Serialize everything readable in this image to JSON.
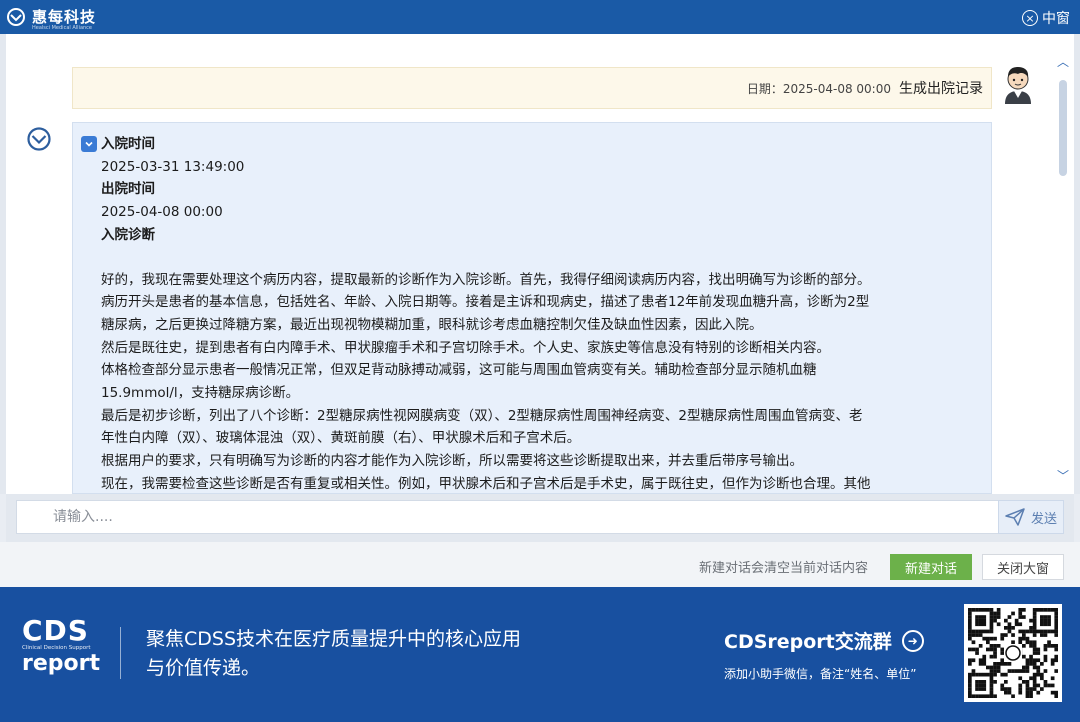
{
  "titlebar": {
    "brand_name": "惠每科技",
    "brand_sub": "Healsci Medical Alliance",
    "window_btn_label": "中窗"
  },
  "chat": {
    "user_message": {
      "date_label": "日期：2025-04-08 00:00",
      "text": "生成出院记录"
    },
    "bot_message": {
      "lines": [
        {
          "kind": "hd",
          "text": "入院时间"
        },
        {
          "kind": "p",
          "text": "2025-03-31 13:49:00"
        },
        {
          "kind": "hd",
          "text": "出院时间"
        },
        {
          "kind": "p",
          "text": "2025-04-08 00:00"
        },
        {
          "kind": "hd",
          "text": "入院诊断"
        },
        {
          "kind": "gap",
          "text": ""
        },
        {
          "kind": "p",
          "text": "好的，我现在需要处理这个病历内容，提取最新的诊断作为入院诊断。首先，我得仔细阅读病历内容，找出明确写为诊断的部分。"
        },
        {
          "kind": "p",
          "text": "病历开头是患者的基本信息，包括姓名、年龄、入院日期等。接着是主诉和现病史，描述了患者12年前发现血糖升高，诊断为2型"
        },
        {
          "kind": "p",
          "text": "糖尿病，之后更换过降糖方案，最近出现视物模糊加重，眼科就诊考虑血糖控制欠佳及缺血性因素，因此入院。"
        },
        {
          "kind": "p",
          "text": "然后是既往史，提到患者有白内障手术、甲状腺瘤手术和子宫切除手术。个人史、家族史等信息没有特别的诊断相关内容。"
        },
        {
          "kind": "p",
          "text": "体格检查部分显示患者一般情况正常，但双足背动脉搏动减弱，这可能与周围血管病变有关。辅助检查部分显示随机血糖"
        },
        {
          "kind": "p",
          "text": "15.9mmol/l，支持糖尿病诊断。"
        },
        {
          "kind": "p",
          "text": "最后是初步诊断，列出了八个诊断：2型糖尿病性视网膜病变（双）、2型糖尿病性周围神经病变、2型糖尿病性周围血管病变、老"
        },
        {
          "kind": "p",
          "text": "年性白内障（双）、玻璃体混浊（双）、黄斑前膜（右）、甲状腺术后和子宫术后。"
        },
        {
          "kind": "p",
          "text": "根据用户的要求，只有明确写为诊断的内容才能作为入院诊断，所以需要将这些诊断提取出来，并去重后带序号输出。"
        },
        {
          "kind": "p",
          "text": "现在，我需要检查这些诊断是否有重复或相关性。例如，甲状腺术后和子宫术后是手术史，属于既往史，但作为诊断也合理。其他"
        }
      ]
    }
  },
  "input": {
    "placeholder": "请输入....",
    "send_label": "发送"
  },
  "actions": {
    "hint": "新建对话会清空当前对话内容",
    "new_chat_label": "新建对话",
    "close_label": "关闭大窗"
  },
  "banner": {
    "logo_big": "CDS",
    "logo_small": "Clinical Decision Support",
    "logo_report": "report",
    "slogan_line1": "聚焦CDSS技术在医疗质量提升中的核心应用",
    "slogan_line2": "与价值传递。",
    "group_title": "CDSreport交流群",
    "group_sub": "添加小助手微信，备注“姓名、单位”"
  },
  "colors": {
    "titlebar": "#1a5aa6",
    "banner": "#1850a0",
    "new_chat_button": "#6cb14a",
    "bot_bubble": "#e8f0fb",
    "user_bubble": "#fdf8ea"
  }
}
